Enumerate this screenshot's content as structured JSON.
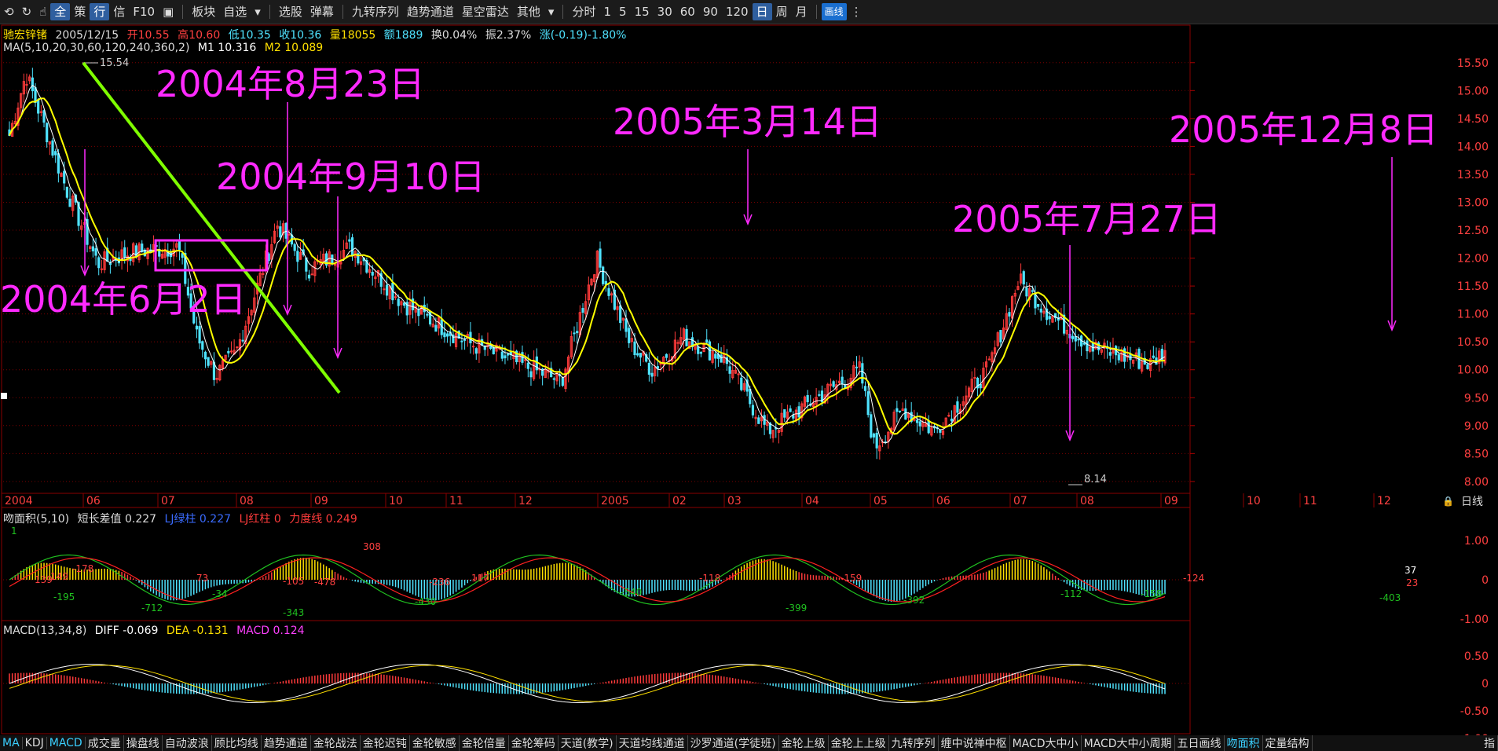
{
  "toolbar": {
    "items": [
      "全",
      "策",
      "行",
      "信",
      "F10",
      "板块",
      "自选",
      "选股",
      "弹幕",
      "九转序列",
      "趋势通道",
      "星空雷达",
      "其他",
      "分时",
      "1",
      "5",
      "15",
      "30",
      "60",
      "90",
      "120",
      "日",
      "周",
      "月",
      "画线"
    ],
    "selected": "日",
    "icons": [
      "back-arrow-icon",
      "refresh-icon",
      "hand-icon",
      "window-icon"
    ]
  },
  "header": {
    "name": "驰宏锌锗",
    "date": "2005/12/15",
    "open": "开10.55",
    "high": "高10.60",
    "low": "低10.35",
    "close": "收10.36",
    "volume": "量18055",
    "amount": "额1889",
    "turnover": "换0.04%",
    "amplitude": "振2.37%",
    "change": "涨(-0.19)-1.80%",
    "ma_label": "MA(5,10,20,30,60,120,240,360,2)",
    "m1": "M1 10.316",
    "m2": "M2 10.089"
  },
  "panel2": {
    "title": "吻面积(5,10)",
    "diff_label": "短长差值 0.227",
    "green": "LJ绿柱 0.227",
    "red": "LJ红柱 0",
    "force": "力度线 0.249",
    "labels": [
      "1",
      "-195",
      "139",
      "149",
      "-178",
      "-712",
      "73",
      "-34",
      "-105",
      "-343",
      "-478",
      "308",
      "-430",
      "-236",
      "117",
      "-540",
      "-118",
      "-399",
      "-392",
      "-159",
      "-112",
      "-158",
      "-124",
      "-403",
      "37",
      "23"
    ]
  },
  "panel3": {
    "title": "MACD(13,34,8)",
    "diff": "DIFF -0.069",
    "dea": "DEA -0.131",
    "macd": "MACD 0.124"
  },
  "axes": {
    "price_ticks": [
      "15.50",
      "15.00",
      "14.50",
      "14.00",
      "13.50",
      "13.00",
      "12.50",
      "12.00",
      "11.50",
      "11.00",
      "10.50",
      "10.00",
      "9.50",
      "9.00",
      "8.50",
      "8.00"
    ],
    "panel2_ticks": [
      "1.00",
      "0",
      "-1.00"
    ],
    "panel3_ticks": [
      "0.50",
      "0",
      "-0.50",
      "-1.00"
    ],
    "months": [
      "2004",
      "06",
      "07",
      "08",
      "09",
      "10",
      "11",
      "12",
      "2005",
      "02",
      "03",
      "04",
      "05",
      "06",
      "07",
      "08",
      "09",
      "10",
      "11",
      "12"
    ],
    "period_label": "日线",
    "high_mark": "15.54",
    "low_mark": "8.14"
  },
  "annotations": [
    "2004年6月2日",
    "2004年8月23日",
    "2004年9月10日",
    "2005年3月14日",
    "2005年7月27日",
    "2005年12月8日"
  ],
  "bottom_tabs": [
    "MA",
    "KDJ",
    "MACD",
    "成交量",
    "操盘线",
    "自动波浪",
    "顾比均线",
    "趋势通道",
    "金轮战法",
    "金轮迟钝",
    "金轮敏感",
    "金轮倍量",
    "金轮筹码",
    "天道(教学)",
    "天道均线通道",
    "沙罗通道(学徒班)",
    "金轮上级",
    "金轮上上级",
    "九转序列",
    "缠中说禅中枢",
    "MACD大中小",
    "MACD大中小周期",
    "五日画线",
    "吻面积",
    "定量结构"
  ],
  "bottom_right": "指",
  "colors": {
    "up": "#ff3b3b",
    "down": "#4fe3ff",
    "ma1": "#ffffff",
    "ma2": "#ffff00",
    "annotation": "#ff2aff",
    "grid": "#7a0000",
    "trend": "#7fff00"
  },
  "chart_data": {
    "type": "candlestick",
    "title": "驰宏锌锗",
    "ylim": [
      7.9,
      15.75
    ],
    "waypoints": [
      {
        "date": "2004-06-02",
        "close": 14.2
      },
      {
        "date": "2004-06-10",
        "close": 15.3
      },
      {
        "date": "2004-06-30",
        "close": 13.2
      },
      {
        "date": "2004-07-15",
        "close": 11.9
      },
      {
        "date": "2004-07-30",
        "close": 12.1
      },
      {
        "date": "2004-08-23",
        "close": 12.2
      },
      {
        "date": "2004-09-01",
        "close": 10.6
      },
      {
        "date": "2004-09-10",
        "close": 9.9
      },
      {
        "date": "2004-09-20",
        "close": 10.3
      },
      {
        "date": "2004-10-10",
        "close": 12.6
      },
      {
        "date": "2004-10-25",
        "close": 11.8
      },
      {
        "date": "2004-11-15",
        "close": 12.2
      },
      {
        "date": "2004-12-10",
        "close": 11.2
      },
      {
        "date": "2005-01-10",
        "close": 10.5
      },
      {
        "date": "2005-02-05",
        "close": 10.1
      },
      {
        "date": "2005-02-25",
        "close": 9.8
      },
      {
        "date": "2005-03-14",
        "close": 12.0
      },
      {
        "date": "2005-03-30",
        "close": 10.5
      },
      {
        "date": "2005-04-10",
        "close": 10.0
      },
      {
        "date": "2005-04-25",
        "close": 10.6
      },
      {
        "date": "2005-05-15",
        "close": 10.2
      },
      {
        "date": "2005-06-05",
        "close": 8.9
      },
      {
        "date": "2005-06-25",
        "close": 9.4
      },
      {
        "date": "2005-07-20",
        "close": 10.0
      },
      {
        "date": "2005-07-27",
        "close": 8.6
      },
      {
        "date": "2005-08-10",
        "close": 9.3
      },
      {
        "date": "2005-08-25",
        "close": 8.9
      },
      {
        "date": "2005-09-20",
        "close": 10.0
      },
      {
        "date": "2005-10-05",
        "close": 11.6
      },
      {
        "date": "2005-10-20",
        "close": 11.0
      },
      {
        "date": "2005-11-10",
        "close": 10.4
      },
      {
        "date": "2005-12-08",
        "close": 10.1
      },
      {
        "date": "2005-12-15",
        "close": 10.36
      }
    ]
  }
}
